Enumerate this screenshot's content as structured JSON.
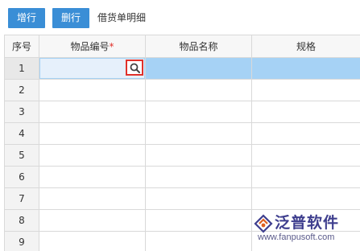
{
  "toolbar": {
    "add_row_label": "增行",
    "delete_row_label": "删行",
    "title": "借货单明细"
  },
  "table": {
    "columns": [
      {
        "label": "序号",
        "required": false
      },
      {
        "label": "物品编号",
        "required": true
      },
      {
        "label": "物品名称",
        "required": false
      },
      {
        "label": "规格",
        "required": false
      }
    ],
    "required_mark": "*",
    "rows": [
      {
        "num": "1",
        "selected": true
      },
      {
        "num": "2"
      },
      {
        "num": "3"
      },
      {
        "num": "4"
      },
      {
        "num": "5"
      },
      {
        "num": "6"
      },
      {
        "num": "7"
      },
      {
        "num": "8"
      },
      {
        "num": "9"
      }
    ]
  },
  "watermark": {
    "name": "泛普软件",
    "url": "www.fanpusoft.com"
  },
  "colors": {
    "button": "#3a8ed6",
    "selected_row": "#a6d2f5",
    "highlight_border": "#e0312a",
    "required_mark": "#e0312a"
  },
  "icons": {
    "lookup": "search-icon",
    "logo": "fanpu-logo-icon"
  }
}
